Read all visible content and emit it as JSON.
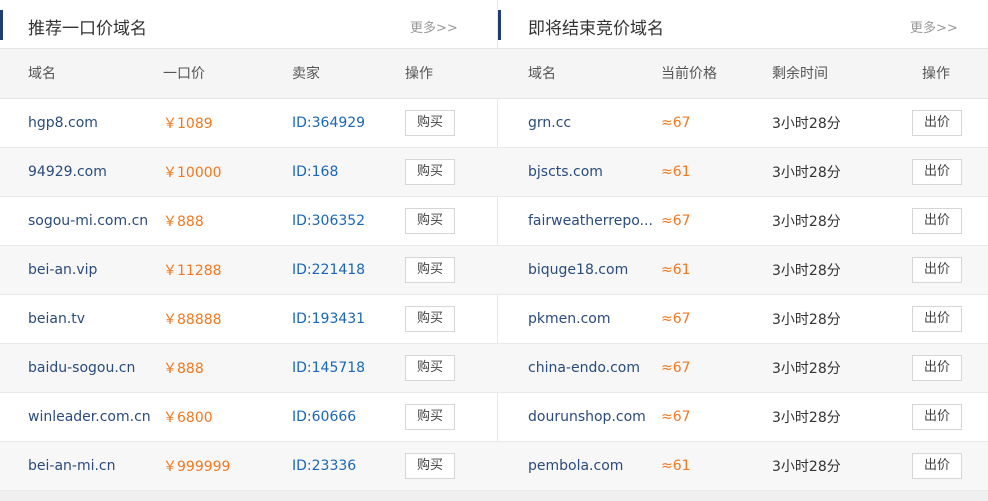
{
  "left": {
    "title": "推荐一口价域名",
    "more": "更多>>",
    "headers": [
      "域名",
      "一口价",
      "卖家",
      "操作"
    ],
    "rows": [
      {
        "domain": "hgp8.com",
        "price": "￥1089",
        "seller": "ID:364929",
        "action": "购买"
      },
      {
        "domain": "94929.com",
        "price": "￥10000",
        "seller": "ID:168",
        "action": "购买"
      },
      {
        "domain": "sogou-mi.com.cn",
        "price": "￥888",
        "seller": "ID:306352",
        "action": "购买"
      },
      {
        "domain": "bei-an.vip",
        "price": "￥11288",
        "seller": "ID:221418",
        "action": "购买"
      },
      {
        "domain": "beian.tv",
        "price": "￥88888",
        "seller": "ID:193431",
        "action": "购买"
      },
      {
        "domain": "baidu-sogou.cn",
        "price": "￥888",
        "seller": "ID:145718",
        "action": "购买"
      },
      {
        "domain": "winleader.com.cn",
        "price": "￥6800",
        "seller": "ID:60666",
        "action": "购买"
      },
      {
        "domain": "bei-an-mi.cn",
        "price": "￥999999",
        "seller": "ID:23336",
        "action": "购买"
      }
    ]
  },
  "right": {
    "title": "即将结束竞价域名",
    "more": "更多>>",
    "headers": [
      "域名",
      "当前价格",
      "剩余时间",
      "操作"
    ],
    "rows": [
      {
        "domain": "grn.cc",
        "price": "≈67",
        "remain": "3小时28分",
        "action": "出价"
      },
      {
        "domain": "bjscts.com",
        "price": "≈61",
        "remain": "3小时28分",
        "action": "出价"
      },
      {
        "domain": "fairweatherrepo...",
        "price": "≈67",
        "remain": "3小时28分",
        "action": "出价"
      },
      {
        "domain": "biquge18.com",
        "price": "≈61",
        "remain": "3小时28分",
        "action": "出价"
      },
      {
        "domain": "pkmen.com",
        "price": "≈67",
        "remain": "3小时28分",
        "action": "出价"
      },
      {
        "domain": "china-endo.com",
        "price": "≈67",
        "remain": "3小时28分",
        "action": "出价"
      },
      {
        "domain": "dourunshop.com",
        "price": "≈67",
        "remain": "3小时28分",
        "action": "出价"
      },
      {
        "domain": "pembola.com",
        "price": "≈61",
        "remain": "3小时28分",
        "action": "出价"
      }
    ]
  },
  "colors": {
    "accent": "#1f3d73",
    "domain": "#2a4b7c",
    "price": "#f07820",
    "seller": "#1a66b8"
  }
}
